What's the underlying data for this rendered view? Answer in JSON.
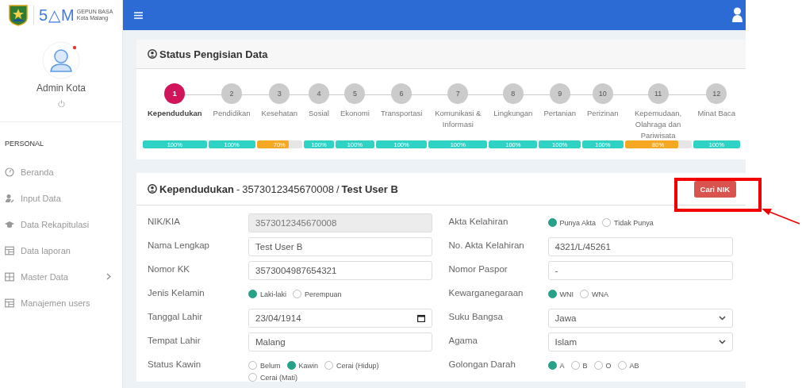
{
  "sidebar": {
    "logo_mark": "5△M",
    "logo_title": "GEPUN BASA",
    "logo_subtitle": "Kota Malang",
    "user_name": "Admin Kota",
    "section": "PERSONAL",
    "items": [
      {
        "label": "Beranda",
        "has_submenu": false
      },
      {
        "label": "Input Data",
        "has_submenu": false
      },
      {
        "label": "Data Rekapitulasi",
        "has_submenu": false
      },
      {
        "label": "Data laporan",
        "has_submenu": false
      },
      {
        "label": "Master Data",
        "has_submenu": true
      },
      {
        "label": "Manajemen users",
        "has_submenu": false
      }
    ]
  },
  "status_card": {
    "title": "Status Pengisian Data",
    "steps": [
      {
        "number": "1",
        "label": "Kependudukan",
        "selected": true,
        "level": 1,
        "percent": "100%"
      },
      {
        "number": "2",
        "label": "Pendidikan",
        "selected": false,
        "level": 1,
        "percent": "100%"
      },
      {
        "number": "3",
        "label": "Kesehatan",
        "selected": false,
        "level": 0.7,
        "percent": "70%"
      },
      {
        "number": "4",
        "label": "Sosial",
        "selected": false,
        "level": 1,
        "percent": "100%"
      },
      {
        "number": "5",
        "label": "Ekonomi",
        "selected": false,
        "level": 1,
        "percent": "100%"
      },
      {
        "number": "6",
        "label": "Transportasi",
        "selected": false,
        "level": 1,
        "percent": "100%"
      },
      {
        "number": "7",
        "label": "Komunikasi & Informasi",
        "selected": false,
        "level": 1,
        "percent": "100%"
      },
      {
        "number": "8",
        "label": "Lingkungan",
        "selected": false,
        "level": 1,
        "percent": "100%"
      },
      {
        "number": "9",
        "label": "Pertanian",
        "selected": false,
        "level": 1,
        "percent": "100%"
      },
      {
        "number": "10",
        "label": "Perizinan",
        "selected": false,
        "level": 1,
        "percent": "100%"
      },
      {
        "number": "11",
        "label": "Kepemudaan, Olahraga dan Pariwisata",
        "selected": false,
        "level": 0.8,
        "percent": "80%"
      },
      {
        "number": "12",
        "label": "Minat Baca",
        "selected": false,
        "level": 1,
        "percent": "100%"
      }
    ]
  },
  "form_card": {
    "title": "Kependudukan",
    "separator_1": "-",
    "nik": "3573012345670008",
    "separator_2": "/",
    "person": "Test User B",
    "button": "Cari NIK",
    "left": [
      {
        "kind": "text",
        "label": "NIK/KIA",
        "value": "3573012345670008",
        "disabled": true
      },
      {
        "kind": "text",
        "label": "Nama Lengkap",
        "value": "Test User B",
        "disabled": false
      },
      {
        "kind": "text",
        "label": "Nomor KK",
        "value": "3573004987654321",
        "disabled": false
      },
      {
        "kind": "radio",
        "label": "Jenis Kelamin",
        "options": [
          {
            "label": "Laki-laki",
            "selected": true
          },
          {
            "label": "Perempuan",
            "selected": false
          }
        ]
      },
      {
        "kind": "date",
        "label": "Tanggal Lahir",
        "value": "23/04/1914"
      },
      {
        "kind": "text",
        "label": "Tempat Lahir",
        "value": "Malang",
        "disabled": false
      },
      {
        "kind": "radio",
        "label": "Status Kawin",
        "options": [
          {
            "label": "Belum",
            "selected": false
          },
          {
            "label": "Kawin",
            "selected": true
          },
          {
            "label": "Cerai (Hidup)",
            "selected": false
          },
          {
            "label": "Cerai (Mati)",
            "selected": false
          }
        ]
      }
    ],
    "right": [
      {
        "kind": "radio",
        "label": "Akta Kelahiran",
        "options": [
          {
            "label": "Punya Akta",
            "selected": true
          },
          {
            "label": "Tidak Punya",
            "selected": false
          }
        ]
      },
      {
        "kind": "text",
        "label": "No. Akta Kelahiran",
        "value": "4321/L/45261",
        "disabled": false
      },
      {
        "kind": "text",
        "label": "Nomor Paspor",
        "value": "-",
        "disabled": false
      },
      {
        "kind": "radio",
        "label": "Kewarganegaraan",
        "options": [
          {
            "label": "WNI",
            "selected": true
          },
          {
            "label": "WNA",
            "selected": false
          }
        ]
      },
      {
        "kind": "select",
        "label": "Suku Bangsa",
        "value": "Jawa"
      },
      {
        "kind": "select",
        "label": "Agama",
        "value": "Islam"
      },
      {
        "kind": "radio",
        "label": "Golongan Darah",
        "options": [
          {
            "label": "A",
            "selected": true
          },
          {
            "label": "B",
            "selected": false
          },
          {
            "label": "O",
            "selected": false
          },
          {
            "label": "AB",
            "selected": false
          }
        ]
      }
    ]
  }
}
